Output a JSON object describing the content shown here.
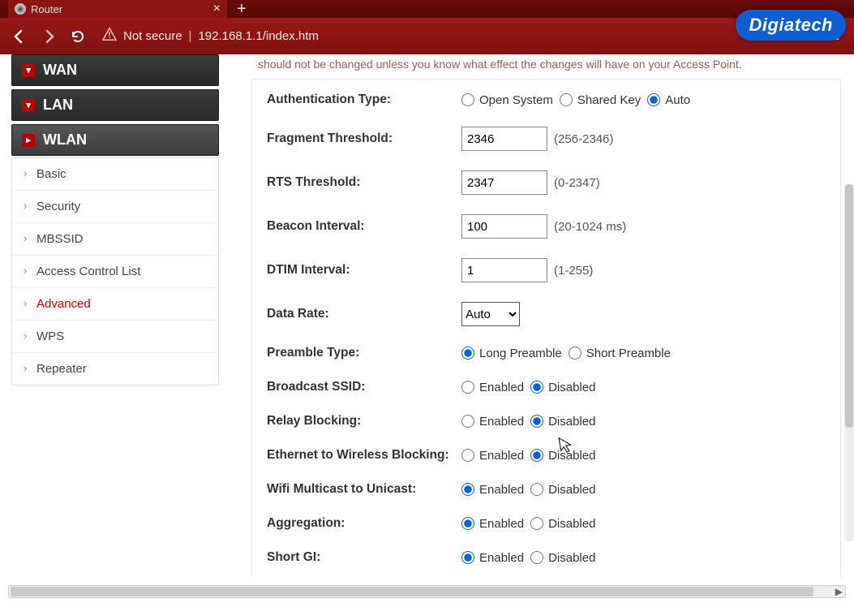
{
  "browser": {
    "tab_title": "Router",
    "not_secure": "Not secure",
    "url": "192.168.1.1/index.htm"
  },
  "logo_text": "Digiatech",
  "sidebar": {
    "sections": [
      {
        "label": "WAN",
        "expanded": false
      },
      {
        "label": "LAN",
        "expanded": false
      },
      {
        "label": "WLAN",
        "expanded": true
      }
    ],
    "wlan_items": [
      {
        "label": "Basic"
      },
      {
        "label": "Security"
      },
      {
        "label": "MBSSID"
      },
      {
        "label": "Access Control List"
      },
      {
        "label": "Advanced",
        "selected": true
      },
      {
        "label": "WPS"
      },
      {
        "label": "Repeater"
      }
    ]
  },
  "hint_text": "should not be changed unless you know what effect the changes will have on your Access Point.",
  "form": {
    "auth": {
      "label": "Authentication Type:",
      "opts": [
        "Open System",
        "Shared Key",
        "Auto"
      ],
      "value": "Auto"
    },
    "fragment": {
      "label": "Fragment Threshold:",
      "value": "2346",
      "note": "(256-2346)"
    },
    "rts": {
      "label": "RTS Threshold:",
      "value": "2347",
      "note": "(0-2347)"
    },
    "beacon": {
      "label": "Beacon Interval:",
      "value": "100",
      "note": "(20-1024 ms)"
    },
    "dtim": {
      "label": "DTIM Interval:",
      "value": "1",
      "note": "(1-255)"
    },
    "datarate": {
      "label": "Data Rate:",
      "value": "Auto"
    },
    "preamble": {
      "label": "Preamble Type:",
      "opts": [
        "Long Preamble",
        "Short Preamble"
      ],
      "value": "Long Preamble"
    },
    "bssid": {
      "label": "Broadcast SSID:",
      "opts": [
        "Enabled",
        "Disabled"
      ],
      "value": "Disabled"
    },
    "relay": {
      "label": "Relay Blocking:",
      "opts": [
        "Enabled",
        "Disabled"
      ],
      "value": "Disabled"
    },
    "eth2w": {
      "label": "Ethernet to Wireless Blocking:",
      "opts": [
        "Enabled",
        "Disabled"
      ],
      "value": "Disabled"
    },
    "mcast": {
      "label": "Wifi Multicast to Unicast:",
      "opts": [
        "Enabled",
        "Disabled"
      ],
      "value": "Enabled"
    },
    "aggr": {
      "label": "Aggregation:",
      "opts": [
        "Enabled",
        "Disabled"
      ],
      "value": "Enabled"
    },
    "shortgi": {
      "label": "Short GI:",
      "opts": [
        "Enabled",
        "Disabled"
      ],
      "value": "Enabled"
    }
  }
}
